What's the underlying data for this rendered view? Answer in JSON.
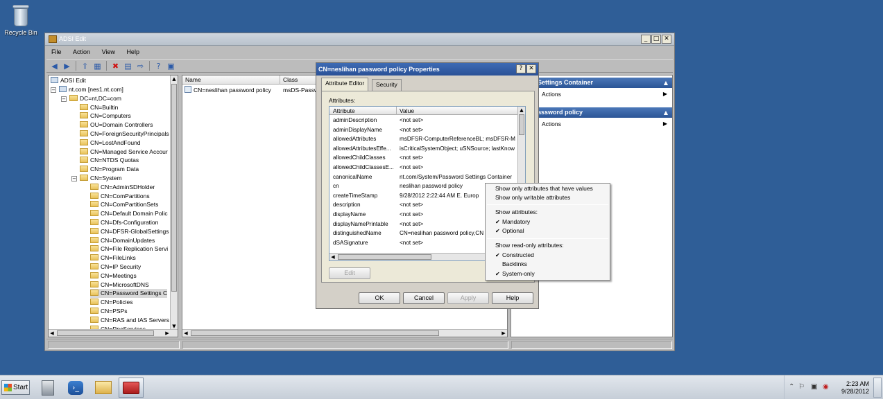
{
  "desktop": {
    "recycle_bin_label": "Recycle Bin"
  },
  "window": {
    "title": "ADSI Edit",
    "controls": {
      "minimize": "_",
      "maximize": "□",
      "close": "✕"
    }
  },
  "menu": [
    "File",
    "Action",
    "View",
    "Help"
  ],
  "tree": {
    "root": "ADSI Edit",
    "items": [
      {
        "label": "nt.com [nes1.nt.com]",
        "level": 1,
        "type": "domain",
        "expander": "−"
      },
      {
        "label": "DC=nt,DC=com",
        "level": 2,
        "type": "folder",
        "expander": "−"
      },
      {
        "label": "CN=Builtin",
        "level": 3,
        "type": "folder"
      },
      {
        "label": "CN=Computers",
        "level": 3,
        "type": "folder"
      },
      {
        "label": "OU=Domain Controllers",
        "level": 3,
        "type": "folder"
      },
      {
        "label": "CN=ForeignSecurityPrincipals",
        "level": 3,
        "type": "folder"
      },
      {
        "label": "CN=LostAndFound",
        "level": 3,
        "type": "folder"
      },
      {
        "label": "CN=Managed Service Accour",
        "level": 3,
        "type": "folder"
      },
      {
        "label": "CN=NTDS Quotas",
        "level": 3,
        "type": "folder"
      },
      {
        "label": "CN=Program Data",
        "level": 3,
        "type": "folder"
      },
      {
        "label": "CN=System",
        "level": 3,
        "type": "folder",
        "expander": "−"
      },
      {
        "label": "CN=AdminSDHolder",
        "level": 4,
        "type": "folder"
      },
      {
        "label": "CN=ComPartitions",
        "level": 4,
        "type": "folder"
      },
      {
        "label": "CN=ComPartitionSets",
        "level": 4,
        "type": "folder"
      },
      {
        "label": "CN=Default Domain Polic",
        "level": 4,
        "type": "folder"
      },
      {
        "label": "CN=Dfs-Configuration",
        "level": 4,
        "type": "folder"
      },
      {
        "label": "CN=DFSR-GlobalSettings",
        "level": 4,
        "type": "folder"
      },
      {
        "label": "CN=DomainUpdates",
        "level": 4,
        "type": "folder"
      },
      {
        "label": "CN=File Replication Servi",
        "level": 4,
        "type": "folder"
      },
      {
        "label": "CN=FileLinks",
        "level": 4,
        "type": "folder"
      },
      {
        "label": "CN=IP Security",
        "level": 4,
        "type": "folder"
      },
      {
        "label": "CN=Meetings",
        "level": 4,
        "type": "folder"
      },
      {
        "label": "CN=MicrosoftDNS",
        "level": 4,
        "type": "folder"
      },
      {
        "label": "CN=Password Settings C",
        "level": 4,
        "type": "folder",
        "selected": true
      },
      {
        "label": "CN=Policies",
        "level": 4,
        "type": "folder"
      },
      {
        "label": "CN=PSPs",
        "level": 4,
        "type": "folder"
      },
      {
        "label": "CN=RAS and IAS Servers",
        "level": 4,
        "type": "folder"
      },
      {
        "label": "CN=RpcServices",
        "level": 4,
        "type": "folder"
      }
    ]
  },
  "listview": {
    "columns": [
      "Name",
      "Class"
    ],
    "rows": [
      {
        "name": "CN=neslihan password policy",
        "class": "msDS-Passw"
      }
    ]
  },
  "actions": {
    "sections": [
      {
        "title": "ssword Settings Container",
        "item": "Actions"
      },
      {
        "title": "slihan password policy",
        "item": "Actions"
      }
    ]
  },
  "dialog": {
    "title": "CN=neslihan password policy Properties",
    "help_button": "?",
    "close_button": "✕",
    "tabs": [
      "Attribute Editor",
      "Security"
    ],
    "attributes_label": "Attributes:",
    "columns": [
      "Attribute",
      "Value"
    ],
    "rows": [
      {
        "name": "adminDescription",
        "value": "<not set>"
      },
      {
        "name": "adminDisplayName",
        "value": "<not set>"
      },
      {
        "name": "allowedAttributes",
        "value": "msDFSR-ComputerReferenceBL; msDFSR-M"
      },
      {
        "name": "allowedAttributesEffe...",
        "value": "isCriticalSystemObject; uSNSource; lastKnow"
      },
      {
        "name": "allowedChildClasses",
        "value": "<not set>"
      },
      {
        "name": "allowedChildClassesE...",
        "value": "<not set>"
      },
      {
        "name": "canonicalName",
        "value": "nt.com/System/Password Settings Container"
      },
      {
        "name": "cn",
        "value": "neslihan password policy"
      },
      {
        "name": "createTimeStamp",
        "value": "9/28/2012 2:22:44 AM E. Europ"
      },
      {
        "name": "description",
        "value": "<not set>"
      },
      {
        "name": "displayName",
        "value": "<not set>"
      },
      {
        "name": "displayNamePrintable",
        "value": "<not set>"
      },
      {
        "name": "distinguishedName",
        "value": "CN=neslihan password policy,CN"
      },
      {
        "name": "dSASignature",
        "value": "<not set>"
      }
    ],
    "edit_button": "Edit",
    "buttons": {
      "ok": "OK",
      "cancel": "Cancel",
      "apply": "Apply",
      "help": "Help"
    }
  },
  "context_menu": {
    "items": [
      {
        "label": "Show only attributes that have values",
        "checked": false
      },
      {
        "label": "Show only writable attributes",
        "checked": false
      }
    ],
    "group1_title": "Show attributes:",
    "group1": [
      {
        "label": "Mandatory",
        "checked": true
      },
      {
        "label": "Optional",
        "checked": true
      }
    ],
    "group2_title": "Show read-only attributes:",
    "group2": [
      {
        "label": "Constructed",
        "checked": true
      },
      {
        "label": "Backlinks",
        "checked": false
      },
      {
        "label": "System-only",
        "checked": true
      }
    ]
  },
  "taskbar": {
    "start_label": "Start",
    "time": "2:23 AM",
    "date": "9/28/2012"
  }
}
